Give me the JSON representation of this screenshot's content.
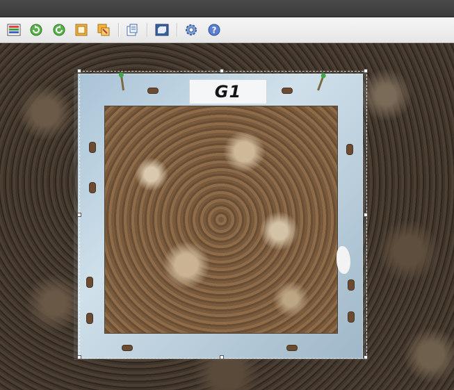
{
  "toolbar": {
    "buttons": [
      {
        "id": "palette",
        "icon": "color-palette-icon"
      },
      {
        "id": "rotate-left",
        "icon": "rotate-left-icon"
      },
      {
        "id": "rotate-right",
        "icon": "rotate-right-icon"
      },
      {
        "id": "crop",
        "icon": "crop-icon"
      },
      {
        "id": "resize",
        "icon": "resize-icon"
      },
      {
        "id": "properties",
        "icon": "properties-icon"
      },
      {
        "id": "fit-window",
        "icon": "fit-to-window-icon"
      },
      {
        "id": "settings",
        "icon": "gear-icon"
      },
      {
        "id": "help",
        "icon": "help-icon"
      }
    ]
  },
  "image": {
    "plot_label": "G1"
  },
  "colors": {
    "accent_blue": "#3a6fc4",
    "toolbar_bg": "#ececec",
    "titlebar_bg": "#404040"
  }
}
